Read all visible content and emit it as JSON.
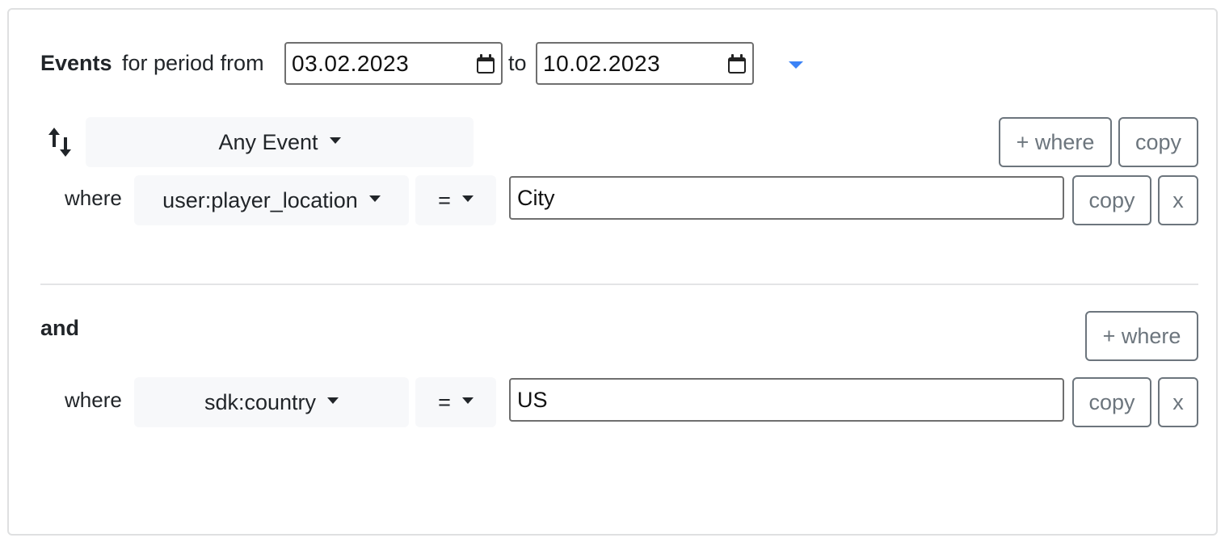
{
  "header": {
    "events_label": "Events",
    "period_from_label": "for period from",
    "date_from": "03.02.2023",
    "to_label": "to",
    "date_to": "10.02.2023",
    "accent_color": "#3b82f6"
  },
  "event_block": {
    "event_select": "Any Event",
    "add_where_label": "+ where",
    "copy_label": "copy",
    "conditions": [
      {
        "where_label": "where",
        "property": "user:player_location",
        "operator": "=",
        "value": "City",
        "copy_label": "copy",
        "remove_label": "x"
      }
    ]
  },
  "and_block": {
    "and_label": "and",
    "add_where_label": "+ where",
    "conditions": [
      {
        "where_label": "where",
        "property": "sdk:country",
        "operator": "=",
        "value": "US",
        "copy_label": "copy",
        "remove_label": "x"
      }
    ]
  }
}
